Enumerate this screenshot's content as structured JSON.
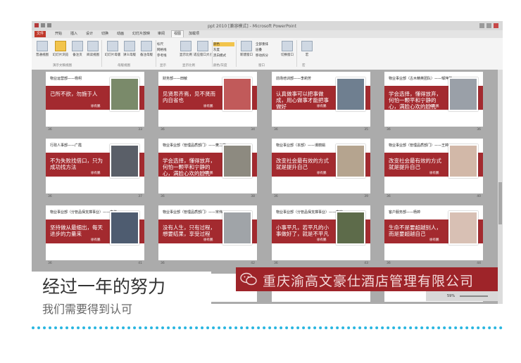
{
  "window": {
    "title": "ppt 2010 [兼容模式] - Microsoft PowerPoint"
  },
  "ribbon_tabs": [
    "文件",
    "开始",
    "插入",
    "设计",
    "切换",
    "动画",
    "幻灯片放映",
    "审阅",
    "视图",
    "加载项"
  ],
  "ribbon": {
    "buttons": [
      "普通视图",
      "幻灯片浏览",
      "备注页",
      "阅读视图",
      "幻灯片母版",
      "讲义母版",
      "备注母版",
      "标尺",
      "网格线",
      "参考线",
      "显示比例",
      "适应窗口大小",
      "颜色",
      "灰度",
      "黑白模式",
      "新建窗口",
      "全部重排",
      "层叠",
      "移动拆分",
      "切换窗口",
      "宏"
    ],
    "groups": [
      "演示文稿视图",
      "母版视图",
      "显示",
      "显示比例",
      "颜色/灰度",
      "窗口",
      "宏"
    ]
  },
  "slides": [
    {
      "header": "物业运营部——杨柯",
      "text": "己所不欲，勿施于人",
      "name": "徐有鹏",
      "photo": "#7a8a6a",
      "left": "36",
      "right": "33"
    },
    {
      "header": "财务部——田敏",
      "text": "见贤思齐焉，见不贤而内自省也",
      "name": "徐有鹏",
      "photo": "#c15a5a",
      "left": "36",
      "right": "34"
    },
    {
      "header": "前场培训部——李莉芳",
      "text": "认真做事可以把事做成，用心做事才能把事做好",
      "name": "徐有鹏",
      "photo": "#6f7f90",
      "left": "36",
      "right": "35"
    },
    {
      "header": "物业事业部（古木精英团队）——邹萍萍",
      "text": "学会选择，懂得放弃，何怕一颗平和宁静的心，满脸心欢的脸孔",
      "name": "徐有鹏",
      "photo": "#9aa0a8",
      "left": "36",
      "right": "36"
    },
    {
      "header": "行政人事部——广霞",
      "text": "不为失败找借口，只为成功找方法",
      "name": "徐有鹏",
      "photo": "#5a5f68",
      "left": "36",
      "right": "37"
    },
    {
      "header": "物业事业部（管理品质部门）——樊二梅",
      "text": "学会选择，懂得放弃，何怕一颗平和宁静的心，满脸心欢的脸孔",
      "name": "徐有鹏",
      "photo": "#8d8a80",
      "left": "36",
      "right": "38"
    },
    {
      "header": "物业事业部（本部）——谭丽娟",
      "text": "改变社会最有效的方式就是提升自己",
      "name": "徐有鹏",
      "photo": "#b5a48f",
      "left": "36",
      "right": "39"
    },
    {
      "header": "物业事业部（管理品质部门）——王婷",
      "text": "改变社会最有效的方式就是提升自己",
      "name": "徐有鹏",
      "photo": "#d2b8a8",
      "left": "36",
      "right": "40"
    },
    {
      "header": "物业事业部（分管品保支撑事业）——李伟",
      "text": "坚持做从最细出，每天进步的力量来",
      "name": "徐有鹏",
      "photo": "#4e5c70",
      "left": "36",
      "right": "41"
    },
    {
      "header": "物业事业部（管理品质部门）——宋伟",
      "text": "没有人生，只有过程，想要结果，享受过程",
      "name": "徐有鹏",
      "photo": "#a0a4a8",
      "left": "36",
      "right": "42"
    },
    {
      "header": "物业事业部（分管品保支撑事业）——李晓",
      "text": "小事平凡，若平凡的小事做好了，就是不平凡",
      "name": "徐有鹏",
      "photo": "#5d6b4a",
      "left": "36",
      "right": "43"
    },
    {
      "header": "客户服务部——杨婷",
      "text": "生命不是要超越别人，而是要超越自己",
      "name": "徐有鹏",
      "photo": "#d8c0b4",
      "left": "36",
      "right": "44"
    }
  ],
  "status": {
    "zoom": "59%"
  },
  "brand": {
    "text": "重庆渝高文豪仕酒店管理有限公司"
  },
  "caption": {
    "title": "经过一年的努力",
    "subtitle": "我们需要得到认可"
  },
  "colors": {
    "accent_red": "#a32a2f",
    "divider_blue": "#29b6e0"
  }
}
